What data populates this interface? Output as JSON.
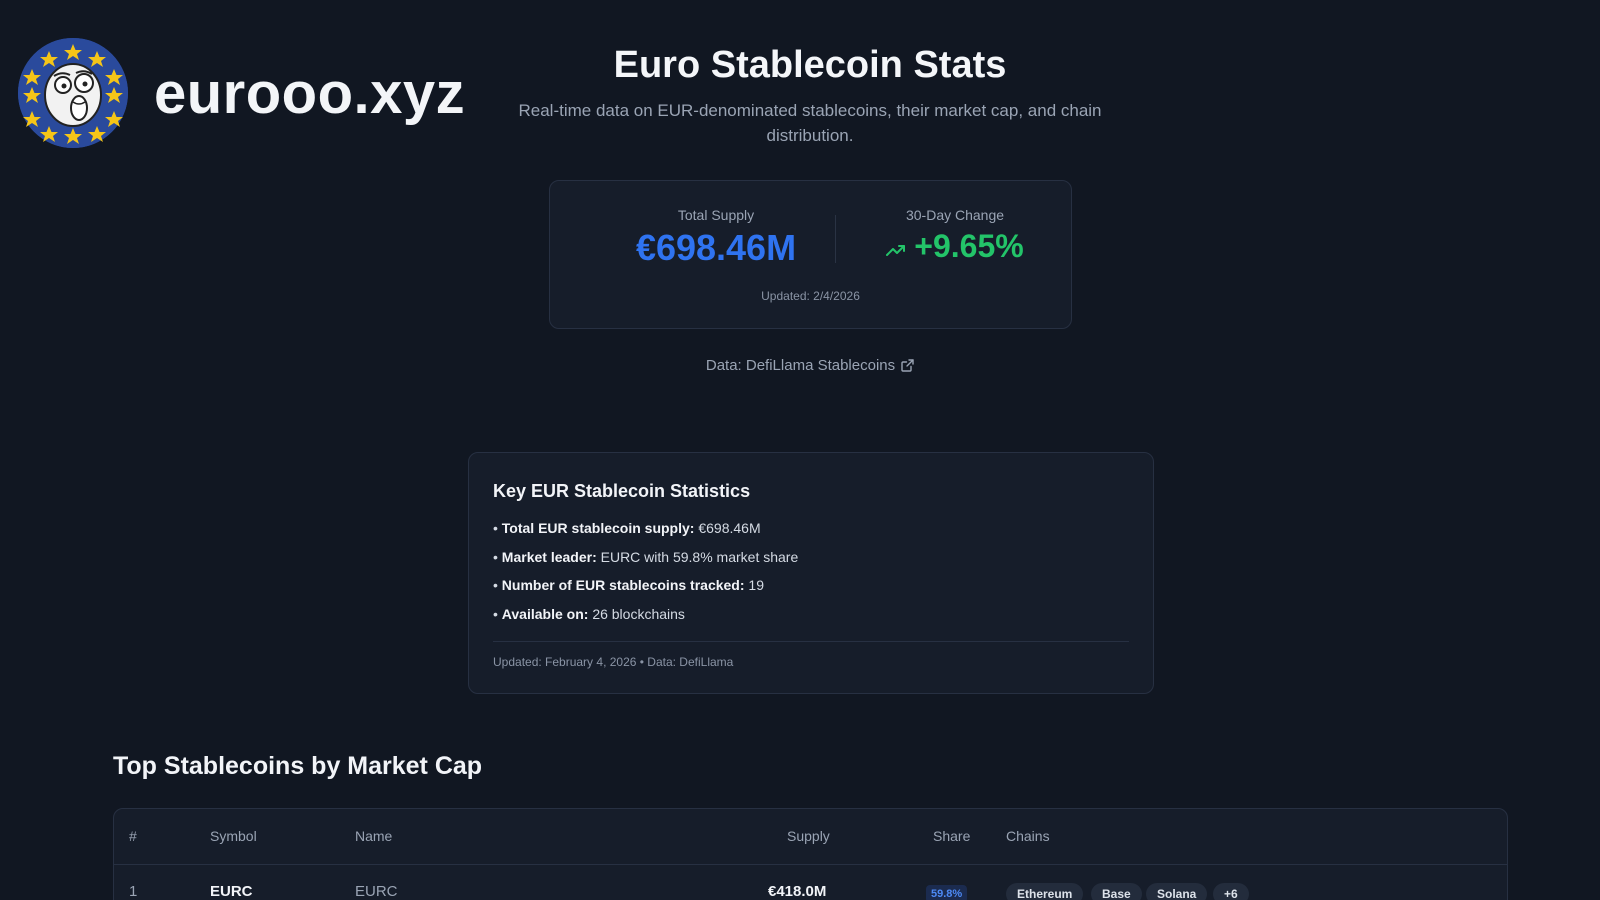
{
  "brand": {
    "name": "eurooo.xyz"
  },
  "hero": {
    "title": "Euro Stablecoin Stats",
    "subtitle": "Real-time data on EUR-denominated stablecoins, their market cap, and chain distribution."
  },
  "summary": {
    "total_supply_label": "Total Supply",
    "total_supply_value": "€698.46M",
    "change_label": "30-Day Change",
    "change_value": "+9.65%",
    "updated": "Updated: 2/4/2026"
  },
  "source": {
    "text": "Data: DefiLlama Stablecoins"
  },
  "key_stats": {
    "title": "Key EUR Stablecoin Statistics",
    "items": [
      {
        "label": "Total EUR stablecoin supply:",
        "value": "€698.46M"
      },
      {
        "label": "Market leader:",
        "value": "EURC with 59.8% market share"
      },
      {
        "label": "Number of EUR stablecoins tracked:",
        "value": "19"
      },
      {
        "label": "Available on:",
        "value": "26 blockchains"
      }
    ],
    "footer": "Updated: February 4, 2026 • Data: DefiLlama"
  },
  "table": {
    "title": "Top Stablecoins by Market Cap",
    "headers": {
      "rank": "#",
      "symbol": "Symbol",
      "name": "Name",
      "supply": "Supply",
      "share": "Share",
      "chains": "Chains"
    },
    "rows": [
      {
        "rank": "1",
        "symbol": "EURC",
        "name": "EURC",
        "supply": "€418.0M",
        "share": "59.8%",
        "chains": [
          "Ethereum",
          "Base",
          "Solana",
          "+6"
        ]
      }
    ]
  },
  "colors": {
    "background": "#111722",
    "card": "#161d2a",
    "accent_blue": "#2f73f0",
    "positive_green": "#23c469",
    "logo_blue": "#2a4a9c",
    "star_gold": "#f5c518"
  },
  "icons": {
    "trend": "trending-up-icon",
    "external": "external-link-icon",
    "logo": "euro-stars-meme-face-logo"
  }
}
